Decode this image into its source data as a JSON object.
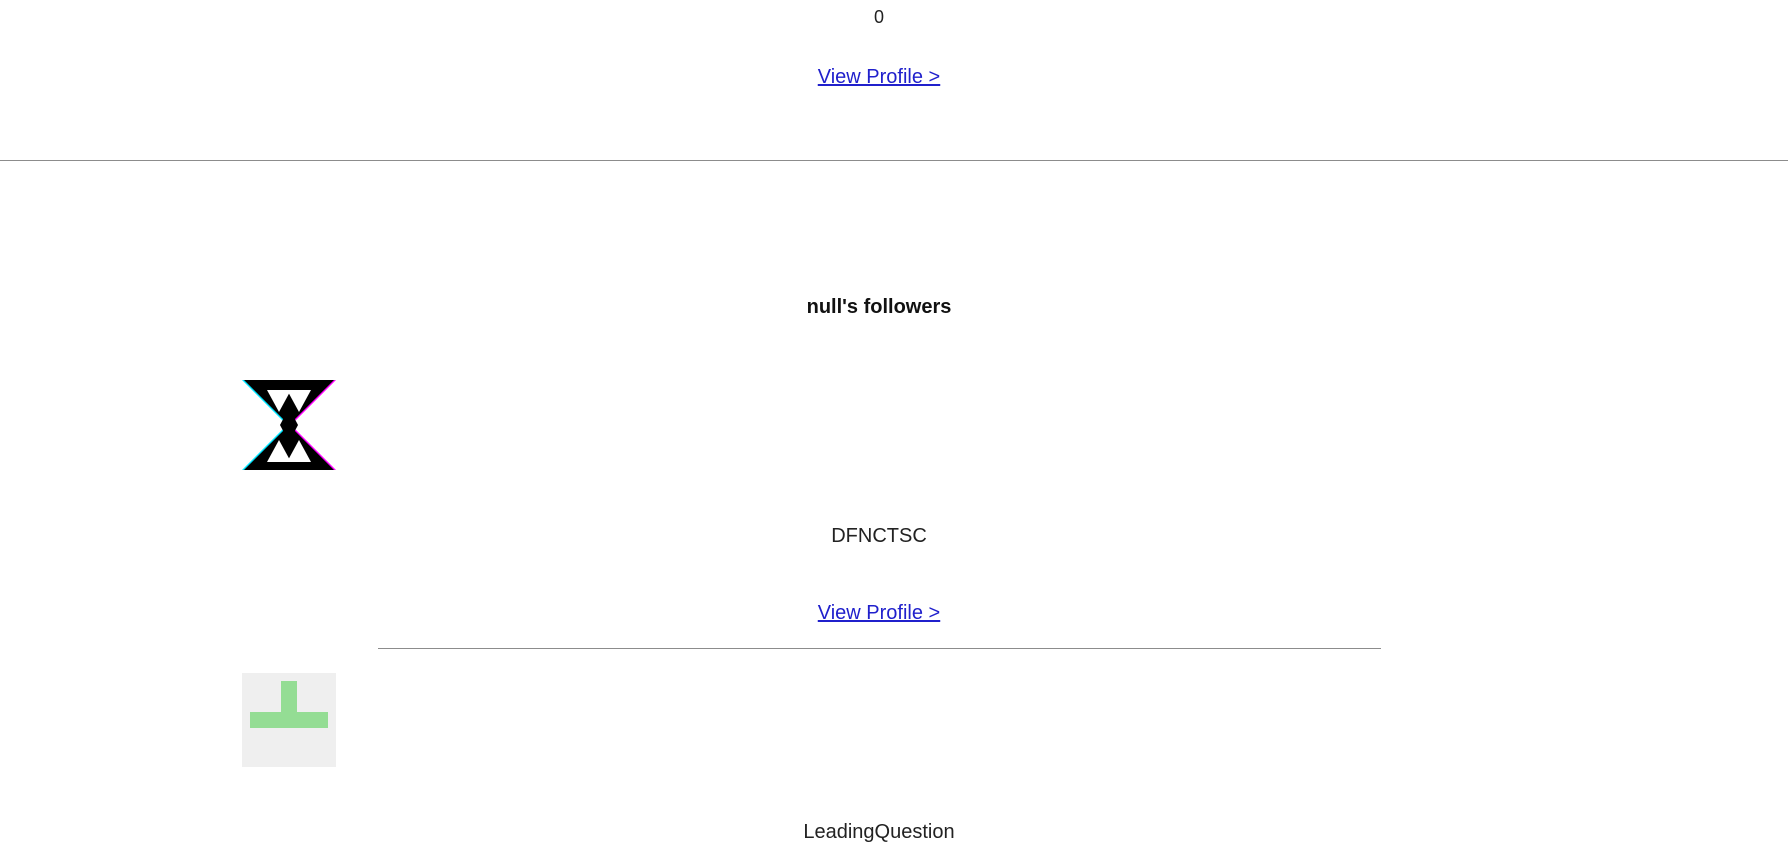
{
  "previous_entry": {
    "count": "0",
    "view_profile_label": "View Profile >"
  },
  "followers": {
    "title": "null's followers",
    "items": [
      {
        "name": "DFNCTSC",
        "avatar_icon": "hourglass-logo-icon",
        "view_profile_label": "View Profile >"
      },
      {
        "name": "LeadingQuestion",
        "avatar_icon": "green-identicon",
        "avatar_color": "#94dd94",
        "avatar_bg": "#efefef"
      }
    ]
  }
}
